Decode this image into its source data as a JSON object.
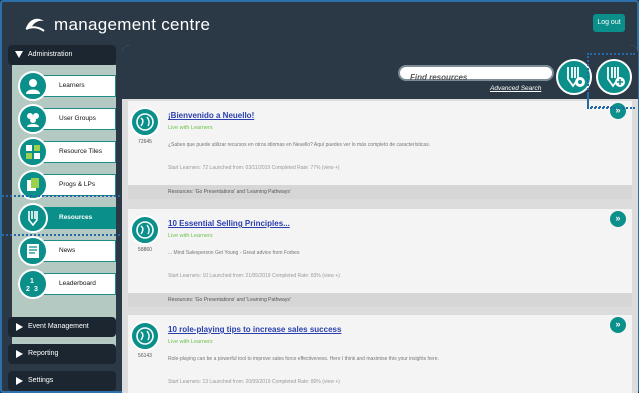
{
  "header": {
    "title": "management centre",
    "logout_label": "Log out"
  },
  "sidebar": {
    "admin_label": "Administration",
    "items": [
      {
        "label": "Learners"
      },
      {
        "label": "User Groups"
      },
      {
        "label": "Resource Tiles"
      },
      {
        "label": "Progs & LPs"
      },
      {
        "label": "Resources"
      },
      {
        "label": "News"
      },
      {
        "label": "Leaderboard"
      }
    ],
    "sections": [
      {
        "label": "Event Management"
      },
      {
        "label": "Reporting"
      },
      {
        "label": "Settings"
      }
    ]
  },
  "toolbar": {
    "search_placeholder": "Find resources",
    "advanced_search_label": "Advanced Search"
  },
  "resources": [
    {
      "title": "¡Bienvenido a Neuello!",
      "subtitle": "Live with Learners",
      "count": "72645",
      "description": "¿Sabes que puede utilizar recursos en otros idiomas en Neuello? Aquí puedes ver lo más completo de características.",
      "meta": "Start Learners: 72 Launched from: 03/11/2019  Completed Rate: 77% (view +)",
      "footer": "Resources: 'Go Presentations' and 'Learning Pathways'"
    },
    {
      "title": "10 Essential Selling Principles...",
      "subtitle": "Live with Learners",
      "count": "58860",
      "description": "... Mind Salesperson Get Young - Great advice from Forbes",
      "meta": "Start Learners: 10 Launched from: 21/05/2019  Completed Rate: 83% (view +)",
      "footer": "Resources: 'Go Presentations' and 'Learning Pathways'"
    },
    {
      "title": "10 role-playing tips to increase sales success",
      "subtitle": "Live with Learners",
      "count": "56143",
      "description": "Role-playing can be a powerful tool to improve sales force effectiveness. Here I think and maximise this your insights here.",
      "meta": "Start Learners: 13 Launched from: 20/09/2019  Completed Rate: 80% (view +)",
      "footer": ""
    }
  ],
  "colors": {
    "accent": "#0a8f8a",
    "header": "#2b3845",
    "link": "#2a3fae"
  }
}
